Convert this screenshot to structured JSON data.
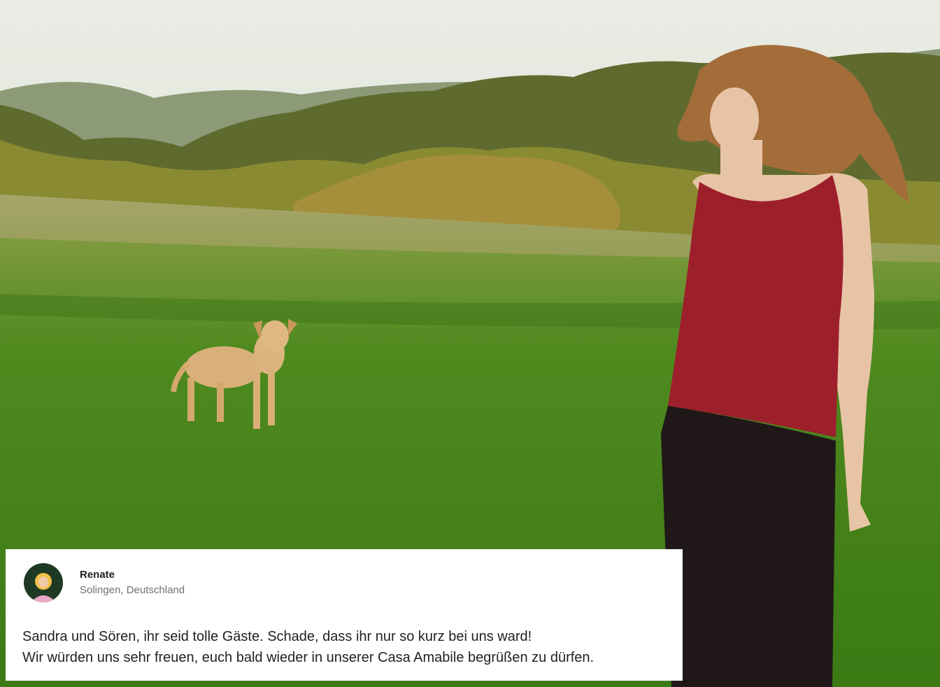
{
  "review": {
    "reviewer_name": "Renate",
    "reviewer_location": "Solingen, Deutschland",
    "lines": [
      "Sandra und Sören, ihr seid tolle Gäste. Schade, dass ihr nur so kurz bei uns ward!",
      "Wir würden uns sehr freuen, euch bald wieder in unserer Casa Amabile begrüßen zu dürfen."
    ]
  },
  "colors": {
    "card_background": "#ffffff",
    "text_primary": "#222222",
    "text_secondary": "#717171"
  }
}
